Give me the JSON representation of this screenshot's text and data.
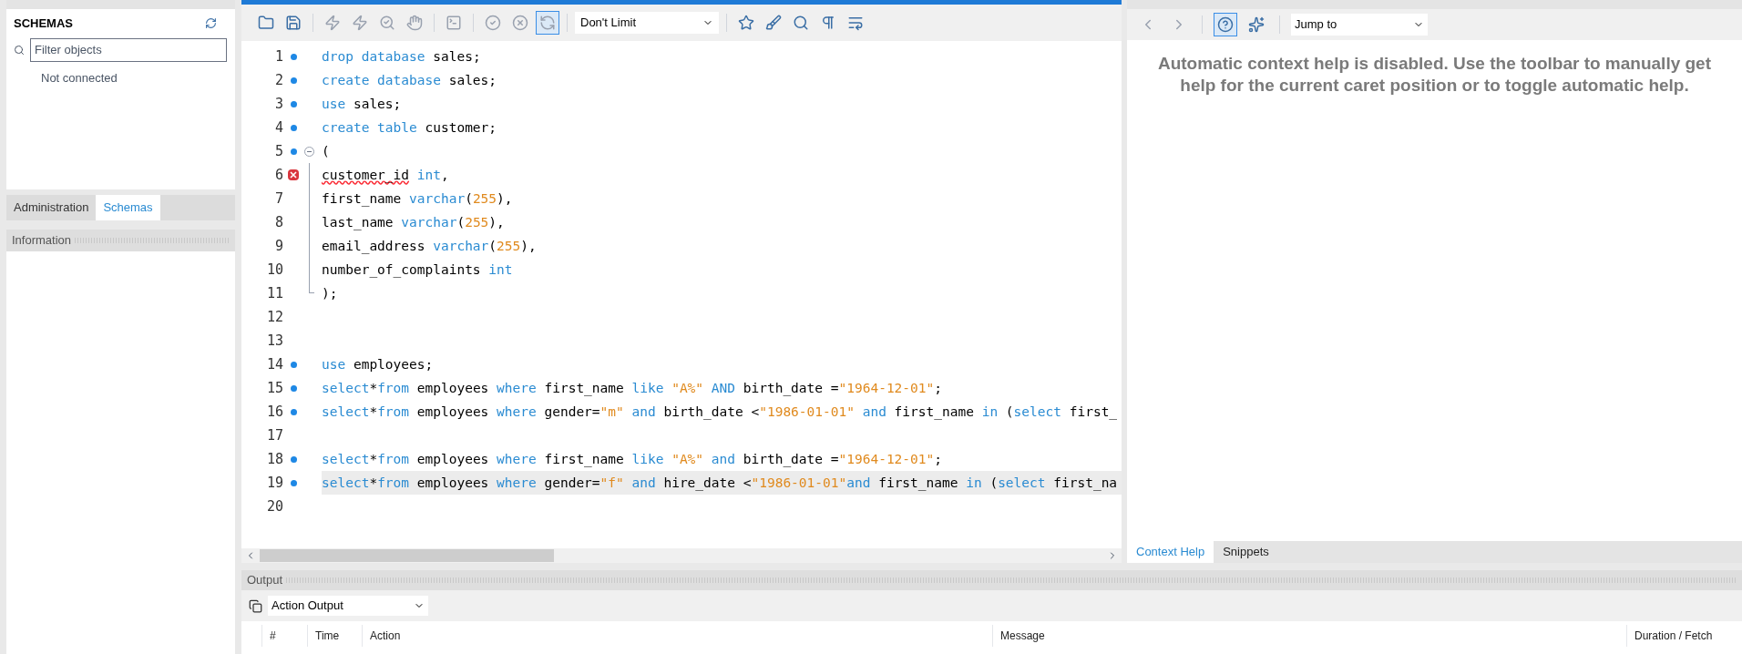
{
  "navigator": {
    "title": "SCHEMAS",
    "filter": {
      "placeholder": "Filter objects"
    },
    "status": "Not connected",
    "tabs": [
      {
        "label": "Administration",
        "selected": false
      },
      {
        "label": "Schemas",
        "selected": true
      }
    ],
    "info_title": "Information"
  },
  "toolbar": {
    "buttons": [
      {
        "disabled": false
      },
      {
        "disabled": false
      },
      {
        "disabled": true
      },
      {
        "disabled": true
      },
      {
        "disabled": true
      },
      {
        "disabled": true
      },
      {
        "disabled": true
      },
      {
        "disabled": true
      },
      {
        "disabled": true
      },
      {
        "disabled": true
      },
      {
        "disabled": false
      },
      {
        "disabled": false
      },
      {
        "disabled": false
      },
      {
        "disabled": false
      },
      {
        "disabled": false
      }
    ],
    "autocommit_on": true,
    "limit": "Don't Limit"
  },
  "editor": {
    "lines": [
      {
        "number": "1",
        "statement": true,
        "error": false,
        "fold_start": false,
        "fold_body": false,
        "fold_end": false,
        "current": false,
        "tokens": [
          {
            "kind": "kw",
            "text": "drop database"
          },
          {
            "kind": "text",
            "text": " sales;"
          }
        ]
      },
      {
        "number": "2",
        "statement": true,
        "error": false,
        "fold_start": false,
        "fold_body": false,
        "fold_end": false,
        "current": false,
        "tokens": [
          {
            "kind": "kw",
            "text": "create database"
          },
          {
            "kind": "text",
            "text": " sales;"
          }
        ]
      },
      {
        "number": "3",
        "statement": true,
        "error": false,
        "fold_start": false,
        "fold_body": false,
        "fold_end": false,
        "current": false,
        "tokens": [
          {
            "kind": "kw",
            "text": "use"
          },
          {
            "kind": "text",
            "text": " sales;"
          }
        ]
      },
      {
        "number": "4",
        "statement": true,
        "error": false,
        "fold_start": false,
        "fold_body": false,
        "fold_end": false,
        "current": false,
        "tokens": [
          {
            "kind": "kw",
            "text": "create table"
          },
          {
            "kind": "text",
            "text": " customer;"
          }
        ]
      },
      {
        "number": "5",
        "statement": true,
        "error": false,
        "fold_start": true,
        "fold_body": false,
        "fold_end": false,
        "current": false,
        "tokens": [
          {
            "kind": "text",
            "text": "("
          }
        ]
      },
      {
        "number": "6",
        "statement": false,
        "error": true,
        "fold_start": false,
        "fold_body": true,
        "fold_end": false,
        "current": false,
        "tokens": [
          {
            "kind": "error",
            "text": "customer_id"
          },
          {
            "kind": "kw",
            "text": " int"
          },
          {
            "kind": "text",
            "text": ","
          }
        ]
      },
      {
        "number": "7",
        "statement": false,
        "error": false,
        "fold_start": false,
        "fold_body": true,
        "fold_end": false,
        "current": false,
        "tokens": [
          {
            "kind": "text",
            "text": "first_name "
          },
          {
            "kind": "kw",
            "text": "varchar"
          },
          {
            "kind": "text",
            "text": "("
          },
          {
            "kind": "str",
            "text": "255"
          },
          {
            "kind": "text",
            "text": "),"
          }
        ]
      },
      {
        "number": "8",
        "statement": false,
        "error": false,
        "fold_start": false,
        "fold_body": true,
        "fold_end": false,
        "current": false,
        "tokens": [
          {
            "kind": "text",
            "text": "last_name "
          },
          {
            "kind": "kw",
            "text": "varchar"
          },
          {
            "kind": "text",
            "text": "("
          },
          {
            "kind": "str",
            "text": "255"
          },
          {
            "kind": "text",
            "text": "),"
          }
        ]
      },
      {
        "number": "9",
        "statement": false,
        "error": false,
        "fold_start": false,
        "fold_body": true,
        "fold_end": false,
        "current": false,
        "tokens": [
          {
            "kind": "text",
            "text": "email_address "
          },
          {
            "kind": "kw",
            "text": "varchar"
          },
          {
            "kind": "text",
            "text": "("
          },
          {
            "kind": "str",
            "text": "255"
          },
          {
            "kind": "text",
            "text": "),"
          }
        ]
      },
      {
        "number": "10",
        "statement": false,
        "error": false,
        "fold_start": false,
        "fold_body": true,
        "fold_end": false,
        "current": false,
        "tokens": [
          {
            "kind": "text",
            "text": "number_of_complaints "
          },
          {
            "kind": "kw",
            "text": "int"
          }
        ]
      },
      {
        "number": "11",
        "statement": false,
        "error": false,
        "fold_start": false,
        "fold_body": false,
        "fold_end": true,
        "current": false,
        "tokens": [
          {
            "kind": "text",
            "text": ");"
          }
        ]
      },
      {
        "number": "12",
        "statement": false,
        "error": false,
        "fold_start": false,
        "fold_body": false,
        "fold_end": false,
        "current": false
      },
      {
        "number": "13",
        "statement": false,
        "error": false,
        "fold_start": false,
        "fold_body": false,
        "fold_end": false,
        "current": false
      },
      {
        "number": "14",
        "statement": true,
        "error": false,
        "fold_start": false,
        "fold_body": false,
        "fold_end": false,
        "current": false,
        "tokens": [
          {
            "kind": "kw",
            "text": "use"
          },
          {
            "kind": "text",
            "text": " employees;"
          }
        ]
      },
      {
        "number": "15",
        "statement": true,
        "error": false,
        "fold_start": false,
        "fold_body": false,
        "fold_end": false,
        "current": false,
        "tokens": [
          {
            "kind": "kw",
            "text": "select"
          },
          {
            "kind": "text",
            "text": "*"
          },
          {
            "kind": "kw",
            "text": "from"
          },
          {
            "kind": "text",
            "text": " employees "
          },
          {
            "kind": "kw",
            "text": "where"
          },
          {
            "kind": "text",
            "text": " first_name "
          },
          {
            "kind": "kw",
            "text": "like "
          },
          {
            "kind": "str",
            "text": "\"A%\""
          },
          {
            "kind": "kw",
            "text": " AND"
          },
          {
            "kind": "text",
            "text": " birth_date ="
          },
          {
            "kind": "str",
            "text": "\"1964-12-01\""
          },
          {
            "kind": "text",
            "text": ";"
          }
        ]
      },
      {
        "number": "16",
        "statement": true,
        "error": false,
        "fold_start": false,
        "fold_body": false,
        "fold_end": false,
        "current": false,
        "tokens": [
          {
            "kind": "kw",
            "text": "select"
          },
          {
            "kind": "text",
            "text": "*"
          },
          {
            "kind": "kw",
            "text": "from"
          },
          {
            "kind": "text",
            "text": " employees "
          },
          {
            "kind": "kw",
            "text": "where"
          },
          {
            "kind": "text",
            "text": " gender="
          },
          {
            "kind": "str",
            "text": "\"m\""
          },
          {
            "kind": "kw",
            "text": " and"
          },
          {
            "kind": "text",
            "text": " birth_date <"
          },
          {
            "kind": "str",
            "text": "\"1986-01-01\""
          },
          {
            "kind": "kw",
            "text": " and"
          },
          {
            "kind": "text",
            "text": " first_name "
          },
          {
            "kind": "kw",
            "text": "in"
          },
          {
            "kind": "text",
            "text": " ("
          },
          {
            "kind": "kw",
            "text": "select"
          },
          {
            "kind": "text",
            "text": " first_"
          }
        ]
      },
      {
        "number": "17",
        "statement": false,
        "error": false,
        "fold_start": false,
        "fold_body": false,
        "fold_end": false,
        "current": false
      },
      {
        "number": "18",
        "statement": true,
        "error": false,
        "fold_start": false,
        "fold_body": false,
        "fold_end": false,
        "current": false,
        "tokens": [
          {
            "kind": "kw",
            "text": "select"
          },
          {
            "kind": "text",
            "text": "*"
          },
          {
            "kind": "kw",
            "text": "from"
          },
          {
            "kind": "text",
            "text": " employees "
          },
          {
            "kind": "kw",
            "text": "where"
          },
          {
            "kind": "text",
            "text": " first_name "
          },
          {
            "kind": "kw",
            "text": "like "
          },
          {
            "kind": "str",
            "text": "\"A%\""
          },
          {
            "kind": "kw",
            "text": " and"
          },
          {
            "kind": "text",
            "text": " birth_date ="
          },
          {
            "kind": "str",
            "text": "\"1964-12-01\""
          },
          {
            "kind": "text",
            "text": ";"
          }
        ]
      },
      {
        "number": "19",
        "statement": true,
        "error": false,
        "fold_start": false,
        "fold_body": false,
        "fold_end": false,
        "current": true,
        "tokens": [
          {
            "kind": "kw",
            "text": "select"
          },
          {
            "kind": "text",
            "text": "*"
          },
          {
            "kind": "kw",
            "text": "from"
          },
          {
            "kind": "text",
            "text": " employees "
          },
          {
            "kind": "kw",
            "text": "where"
          },
          {
            "kind": "text",
            "text": " gender="
          },
          {
            "kind": "str",
            "text": "\"f\""
          },
          {
            "kind": "kw",
            "text": " and"
          },
          {
            "kind": "text",
            "text": " hire_date <"
          },
          {
            "kind": "str",
            "text": "\"1986-01-01\""
          },
          {
            "kind": "kw",
            "text": "and"
          },
          {
            "kind": "text",
            "text": " first_name "
          },
          {
            "kind": "kw",
            "text": "in"
          },
          {
            "kind": "text",
            "text": " ("
          },
          {
            "kind": "kw",
            "text": "select"
          },
          {
            "kind": "text",
            "text": " first_na"
          }
        ]
      },
      {
        "number": "20",
        "statement": false,
        "error": false,
        "fold_start": false,
        "fold_body": false,
        "fold_end": false,
        "current": false
      }
    ]
  },
  "help": {
    "buttons": [
      {
        "disabled": true,
        "on": false
      },
      {
        "disabled": true,
        "on": false
      },
      {
        "disabled": false,
        "on": true
      },
      {
        "disabled": false,
        "on": false
      }
    ],
    "jump": "Jump to",
    "message": "Automatic context help is disabled. Use the toolbar to manually get help for the current caret position or to toggle automatic help.",
    "tabs": [
      {
        "label": "Context Help",
        "selected": true
      },
      {
        "label": "Snippets",
        "selected": false
      }
    ]
  },
  "output": {
    "title": "Output",
    "mode": "Action Output",
    "columns": [
      "#",
      "Time",
      "Action",
      "Message",
      "Duration / Fetch"
    ]
  }
}
